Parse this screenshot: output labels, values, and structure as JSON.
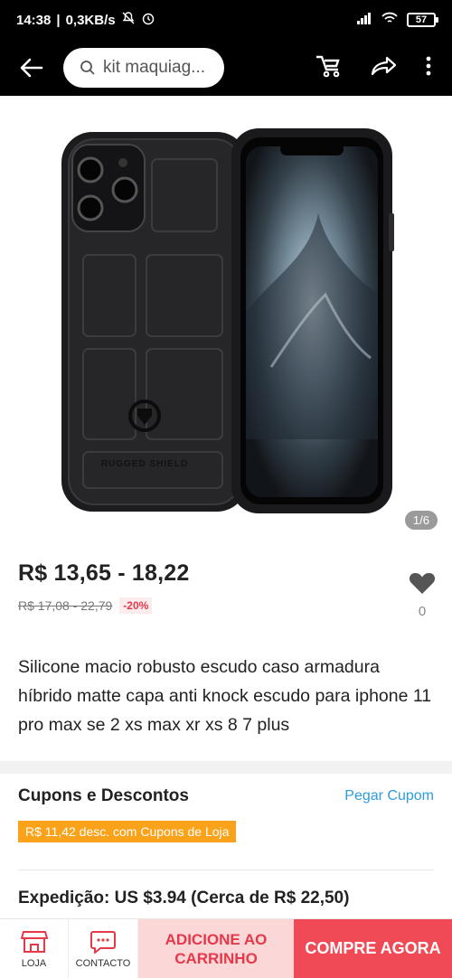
{
  "status_bar": {
    "time": "14:38",
    "speed": "0,3KB/s",
    "battery": "57"
  },
  "header": {
    "search_text": "kit maquiag..."
  },
  "gallery": {
    "counter": "1/6"
  },
  "product": {
    "price_range": "R$ 13,65 - 18,22",
    "old_price_range": "R$ 17,08 - 22,79",
    "discount": "-20%",
    "wishlist_count": "0",
    "title": "Silicone macio robusto escudo caso armadura híbrido matte capa anti knock escudo para iphone 11 pro max se 2 xs max xr xs 8 7 plus"
  },
  "coupons": {
    "title": "Cupons e Descontos",
    "link": "Pegar Cupom",
    "chip": "R$ 11,42 desc. com Cupons de Loja"
  },
  "shipping": {
    "text": "Expedição: US $3.94 (Cerca de R$ 22,50)"
  },
  "bottom_bar": {
    "store_label": "LOJA",
    "contact_label": "CONTACTO",
    "add_to_cart_label": "ADICIONE AO CARRINHO",
    "buy_now_label": "COMPRE AGORA"
  },
  "colors": {
    "accent_red": "#f04a56",
    "light_red": "#fbd7d7",
    "link_blue": "#2d9cdb",
    "coupon_orange": "#fba21b"
  },
  "icons": [
    "back-arrow-icon",
    "search-icon",
    "cart-icon",
    "share-icon",
    "more-vertical-icon",
    "heart-icon",
    "store-icon",
    "chat-icon"
  ]
}
